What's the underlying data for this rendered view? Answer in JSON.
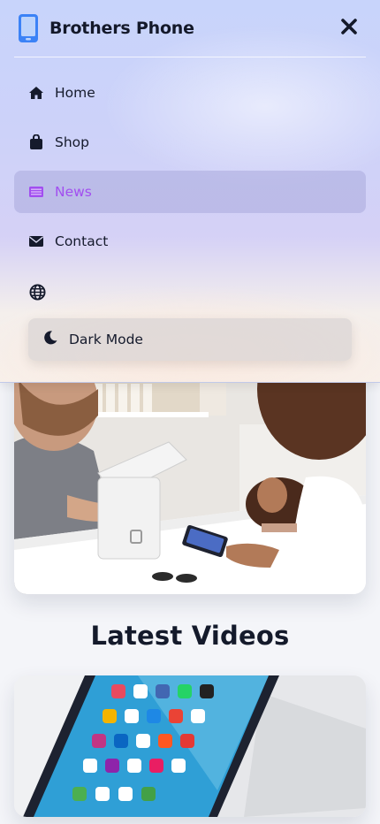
{
  "header": {
    "brand_name": "Brothers Phone",
    "brand_icon": "smartphone-icon",
    "close_icon": "close-icon"
  },
  "menu": {
    "items": [
      {
        "label": "Home",
        "icon": "home-icon",
        "active": false
      },
      {
        "label": "Shop",
        "icon": "shopping-bag-icon",
        "active": false
      },
      {
        "label": "News",
        "icon": "newspaper-icon",
        "active": true
      },
      {
        "label": "Contact",
        "icon": "envelope-icon",
        "active": false
      }
    ],
    "language_icon": "globe-icon",
    "dark_mode": {
      "label": "Dark Mode",
      "icon": "moon-icon"
    }
  },
  "main": {
    "videos_title": "Latest Videos"
  },
  "colors": {
    "accent": "#a24ef0",
    "brand_blue": "#3b82f6",
    "text": "#151a2c"
  }
}
